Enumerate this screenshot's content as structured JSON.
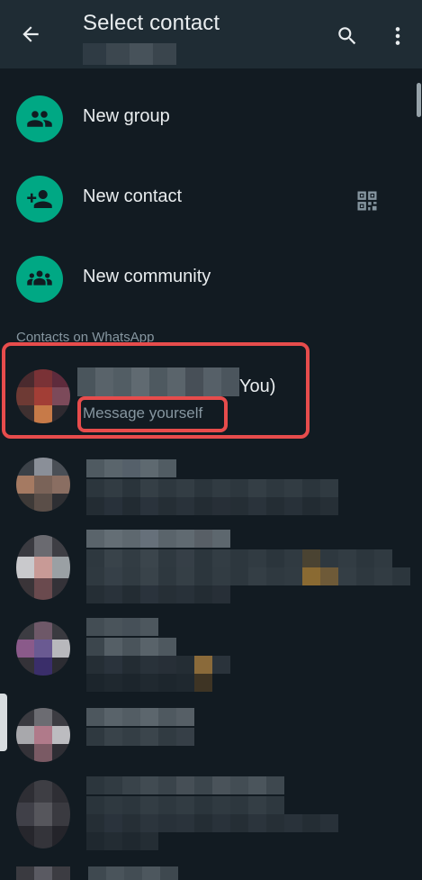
{
  "appbar": {
    "title": "Select contact"
  },
  "actions": [
    {
      "label": "New group",
      "icon": "group-icon"
    },
    {
      "label": "New contact",
      "icon": "add-person-icon",
      "trailing_icon": "qr-code-icon"
    },
    {
      "label": "New community",
      "icon": "community-icon"
    }
  ],
  "section": {
    "title": "Contacts on WhatsApp"
  },
  "self_contact": {
    "name_suffix": "You)",
    "status": "Message yourself"
  },
  "colors": {
    "accent": "#00a884",
    "background": "#121b22",
    "appbar": "#1f2c34",
    "highlight": "#e74c4c",
    "secondary_text": "#8696a0"
  }
}
